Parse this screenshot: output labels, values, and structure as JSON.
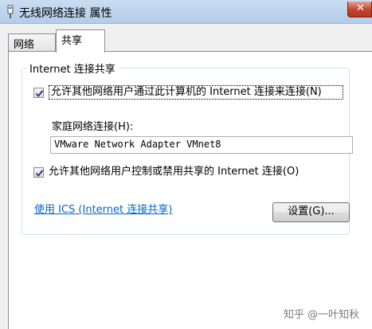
{
  "window": {
    "title": "无线网络连接 属性",
    "close_label": "✕"
  },
  "tabs": [
    {
      "label": "网络",
      "active": false
    },
    {
      "label": "共享",
      "active": true
    }
  ],
  "group": {
    "title": "Internet 连接共享"
  },
  "options": {
    "allow_share": {
      "label": "允许其他网络用户通过此计算机的 Internet 连接来连接(N)",
      "checked": true
    },
    "allow_control": {
      "label": "允许其他网络用户控制或禁用共享的 Internet 连接(O)",
      "checked": true
    }
  },
  "home_network": {
    "label": "家庭网络连接(H):",
    "value": "VMware Network Adapter VMnet8"
  },
  "ics_link": "使用 ICS (Internet 连接共享)",
  "settings_button": "设置(G)...",
  "watermark": "知乎 @一叶知秋"
}
